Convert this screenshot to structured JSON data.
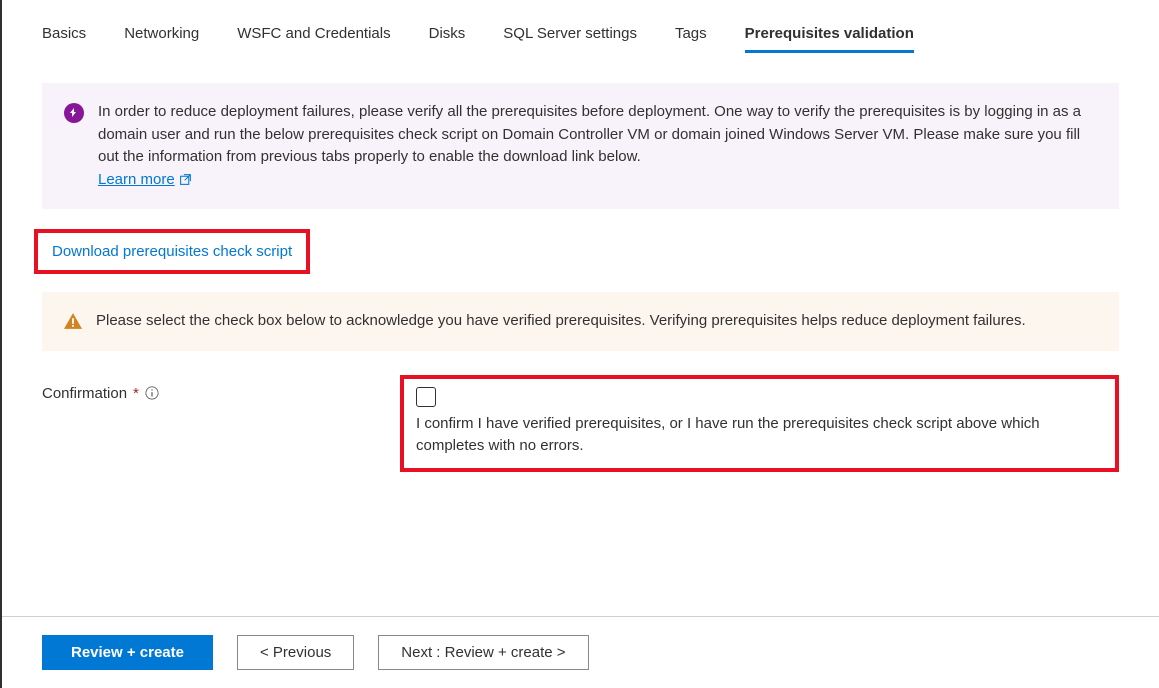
{
  "tabs": [
    {
      "label": "Basics"
    },
    {
      "label": "Networking"
    },
    {
      "label": "WSFC and Credentials"
    },
    {
      "label": "Disks"
    },
    {
      "label": "SQL Server settings"
    },
    {
      "label": "Tags"
    },
    {
      "label": "Prerequisites validation",
      "active": true
    }
  ],
  "infoBox": {
    "text": "In order to reduce deployment failures, please verify all the prerequisites before deployment. One way to verify the prerequisites is by logging in as a domain user and run the below prerequisites check script on Domain Controller VM or domain joined Windows Server VM. Please make sure you fill out the information from previous tabs properly to enable the download link below.",
    "learnMore": "Learn more"
  },
  "downloadLink": "Download prerequisites check script",
  "warningBox": {
    "text": "Please select the check box below to acknowledge you have verified prerequisites. Verifying prerequisites helps reduce deployment failures."
  },
  "confirmation": {
    "label": "Confirmation",
    "text": "I confirm I have verified prerequisites, or I have run the prerequisites check script above which completes with no errors."
  },
  "footer": {
    "reviewCreate": "Review + create",
    "previous": "< Previous",
    "next": "Next : Review + create >"
  }
}
